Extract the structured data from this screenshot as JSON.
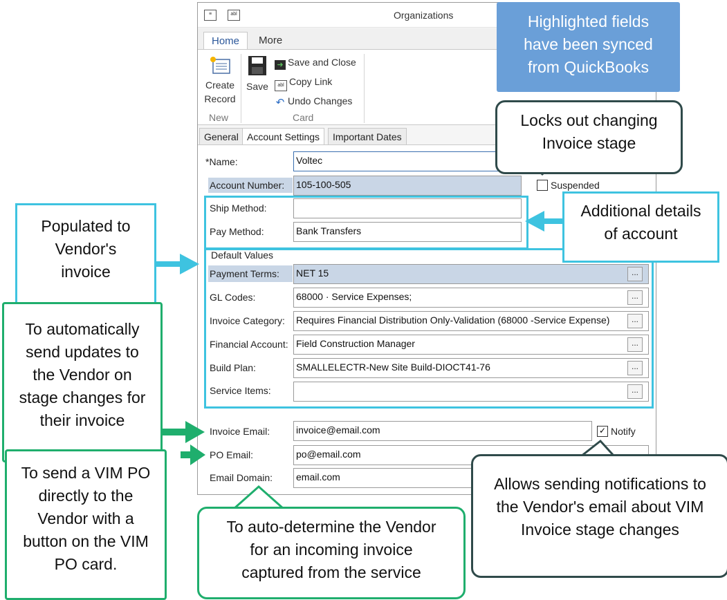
{
  "window": {
    "title": "Organizations",
    "ribbon_tabs": [
      "Home",
      "More"
    ],
    "ribbon": {
      "create_record": {
        "line1": "Create",
        "line2": "Record"
      },
      "new_group": "New",
      "save": "Save",
      "save_and_close": "Save and Close",
      "copy_link": "Copy Link",
      "undo_changes": "Undo Changes",
      "card_group": "Card"
    },
    "content_tabs": [
      "General",
      "Account Settings",
      "Important Dates"
    ]
  },
  "form": {
    "name_label": "*Name:",
    "name_value": "Voltec",
    "account_number_label": "Account Number:",
    "account_number_value": "105-100-505",
    "suspended_label": "Suspended",
    "ship_method_label": "Ship Method:",
    "ship_method_value": "",
    "pay_method_label": "Pay Method:",
    "pay_method_value": "Bank Transfers",
    "default_values_title": "Default Values",
    "payment_terms_label": "Payment Terms:",
    "payment_terms_value": "NET 15",
    "gl_codes_label": "GL Codes:",
    "gl_codes_value": "68000 · Service Expenses;",
    "invoice_category_label": "Invoice Category:",
    "invoice_category_value": "Requires Financial Distribution Only-Validation (68000 -Service Expense)",
    "financial_account_label": "Financial Account:",
    "financial_account_value": "Field Construction Manager",
    "build_plan_label": "Build Plan:",
    "build_plan_value": "SMALLELECTR-New Site Build-DIOCT41-76",
    "service_items_label": "Service Items:",
    "service_items_value": "",
    "invoice_email_label": "Invoice Email:",
    "invoice_email_value": "invoice@email.com",
    "notify_label": "Notify",
    "po_email_label": "PO Email:",
    "po_email_value": "po@email.com",
    "email_domain_label": "Email Domain:",
    "email_domain_value": "email.com",
    "ellipsis": "..."
  },
  "callouts": {
    "highlighted": [
      "Highlighted fields",
      "have been synced",
      "from QuickBooks"
    ],
    "locks": [
      "Locks out changing",
      "Invoice stage"
    ],
    "additional": [
      "Additional details",
      "of account"
    ],
    "populated": [
      "Populated to",
      "Vendor's",
      "invoice"
    ],
    "auto_send": [
      "To automatically",
      "send updates to",
      "the Vendor on",
      "stage changes for",
      "their invoice"
    ],
    "vim_po": [
      "To send a VIM PO",
      "directly to the",
      "Vendor with a",
      "button on the VIM",
      "PO card."
    ],
    "auto_determine": [
      "To auto-determine  the Vendor",
      "for an incoming invoice",
      "captured from the service"
    ],
    "notifications": [
      "Allows sending notifications to",
      "the Vendor's email about  VIM",
      "Invoice stage changes"
    ]
  },
  "colors": {
    "highlight": "#c9d6e6",
    "cyan": "#3ec3e0",
    "green": "#1fae6d",
    "dark_callout": "#2f4a4a",
    "info_box": "#6a9fd8"
  }
}
